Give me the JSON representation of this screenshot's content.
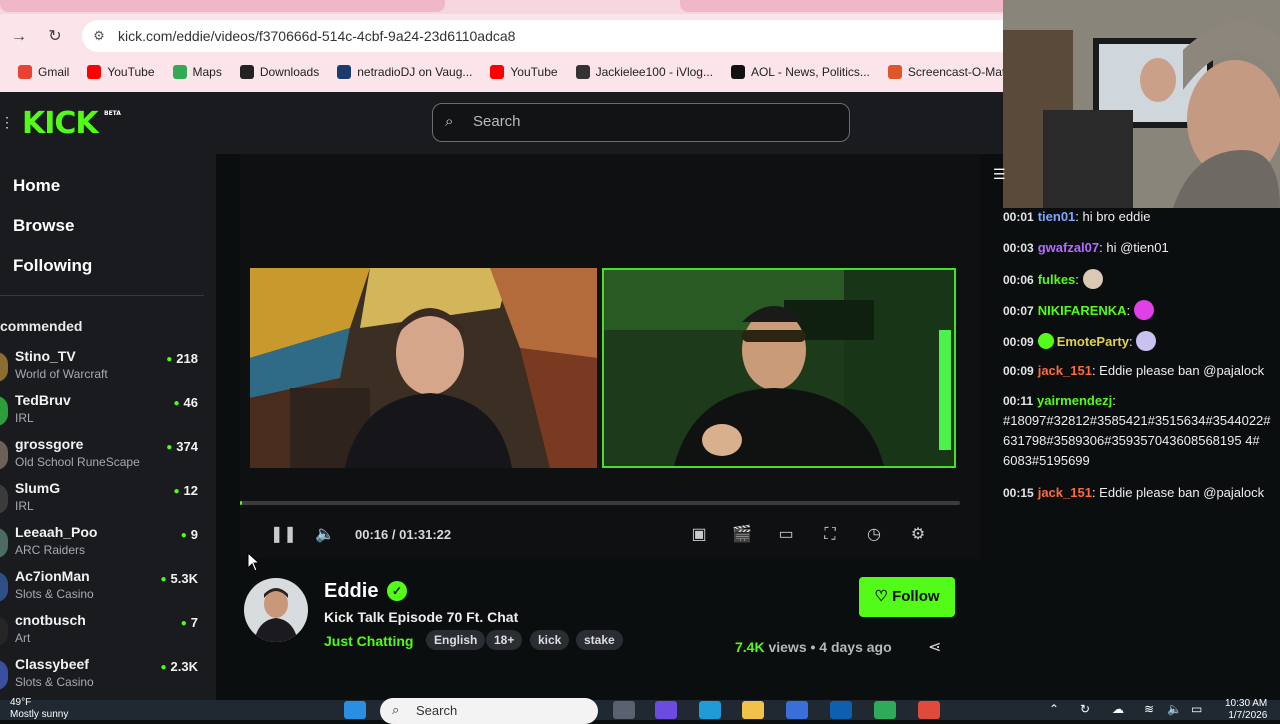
{
  "browser": {
    "url": "kick.com/eddie/videos/f370666d-514c-4cbf-9a24-23d6110adca8",
    "bookmarks": [
      {
        "label": "Gmail",
        "icon": "gmail-icon",
        "color": "#ea4335"
      },
      {
        "label": "YouTube",
        "icon": "youtube-icon",
        "color": "#ff0000"
      },
      {
        "label": "Maps",
        "icon": "maps-icon",
        "color": "#34a853"
      },
      {
        "label": "Downloads",
        "icon": "download-icon",
        "color": "#222222"
      },
      {
        "label": "netradioDJ on Vaug...",
        "icon": "vaughn-icon",
        "color": "#1c3a6b"
      },
      {
        "label": "YouTube",
        "icon": "youtube-icon",
        "color": "#ff0000"
      },
      {
        "label": "Jackielee100 - iVlog...",
        "icon": "vlog-icon",
        "color": "#333333"
      },
      {
        "label": "AOL - News, Politics...",
        "icon": "aol-icon",
        "color": "#111111"
      },
      {
        "label": "Screencast-O-Matic",
        "icon": "screencast-icon",
        "color": "#e0562b"
      }
    ]
  },
  "site": {
    "logo": "KICK",
    "logo_badge": "BETA",
    "search_placeholder": "Search",
    "accent": "#53fc18"
  },
  "sidebar": {
    "nav": [
      "Home",
      "Browse",
      "Following"
    ],
    "recommended_label": "commended",
    "channels": [
      {
        "name": "Stino_TV",
        "category": "World of Warcraft",
        "viewers": "218",
        "avatar_color": "#8a6d2f"
      },
      {
        "name": "TedBruv",
        "category": "IRL",
        "viewers": "46",
        "avatar_color": "#2e9e3a"
      },
      {
        "name": "grossgore",
        "category": "Old School RuneScape",
        "viewers": "374",
        "avatar_color": "#6b6157"
      },
      {
        "name": "SlumG",
        "category": "IRL",
        "viewers": "12",
        "avatar_color": "#3b3b3b"
      },
      {
        "name": "Leeaah_Poo",
        "category": "ARC Raiders",
        "viewers": "9",
        "avatar_color": "#4d6b63"
      },
      {
        "name": "Ac7ionMan",
        "category": "Slots & Casino",
        "viewers": "5.3K",
        "avatar_color": "#2f4f88"
      },
      {
        "name": "cnotbusch",
        "category": "Art",
        "viewers": "7",
        "avatar_color": "#262626"
      },
      {
        "name": "Classybeef",
        "category": "Slots & Casino",
        "viewers": "2.3K",
        "avatar_color": "#3a4fa0"
      }
    ]
  },
  "player": {
    "time": "00:16 / 01:31:22",
    "progress": 0.003
  },
  "video": {
    "channel": "Eddie",
    "title": "Kick Talk Episode 70 Ft. Chat",
    "category": "Just Chatting",
    "tags": [
      "English",
      "18+",
      "kick",
      "stake"
    ],
    "follow_label": "Follow",
    "views": "7.4K",
    "views_word": "views",
    "age": "4 days ago"
  },
  "chat": {
    "messages": [
      {
        "ts": "00:01",
        "user": "tien01",
        "color": "#7ea6ff",
        "text": "hi bro eddie"
      },
      {
        "ts": "00:03",
        "user": "gwafzal07",
        "color": "#b46cff",
        "text": "hi @tien01"
      },
      {
        "ts": "00:06",
        "user": "fulkes",
        "color": "#53fc18",
        "text": "",
        "emote_color": "#d9c9b5"
      },
      {
        "ts": "00:07",
        "user": "NIKIFARENKA",
        "color": "#53fc18",
        "text": "",
        "emote_color": "#e040e8"
      },
      {
        "ts": "00:09",
        "user": "EmoteParty",
        "color": "#e0d24a",
        "text": "",
        "emote_color": "#c9c2f0",
        "badge": true
      },
      {
        "ts": "00:09",
        "user": "jack_151",
        "color": "#ff6a3d",
        "text": "Eddie please ban @pajalock"
      },
      {
        "ts": "00:11",
        "user": "yairmendezj",
        "color": "#53fc18",
        "text": "",
        "lines": [
          "#18097#32812#3585421#3515634#3544022#",
          "631798#3589306#359357043608568195 4#",
          "6083#5195699"
        ]
      },
      {
        "ts": "00:15",
        "user": "jack_151",
        "color": "#ff6a3d",
        "text": "Eddie please ban @pajalock"
      }
    ]
  },
  "taskbar": {
    "temp": "49°F",
    "weather": "Mostly sunny",
    "search": "Search",
    "time": "10:30 AM",
    "date": "1/7/2026"
  }
}
